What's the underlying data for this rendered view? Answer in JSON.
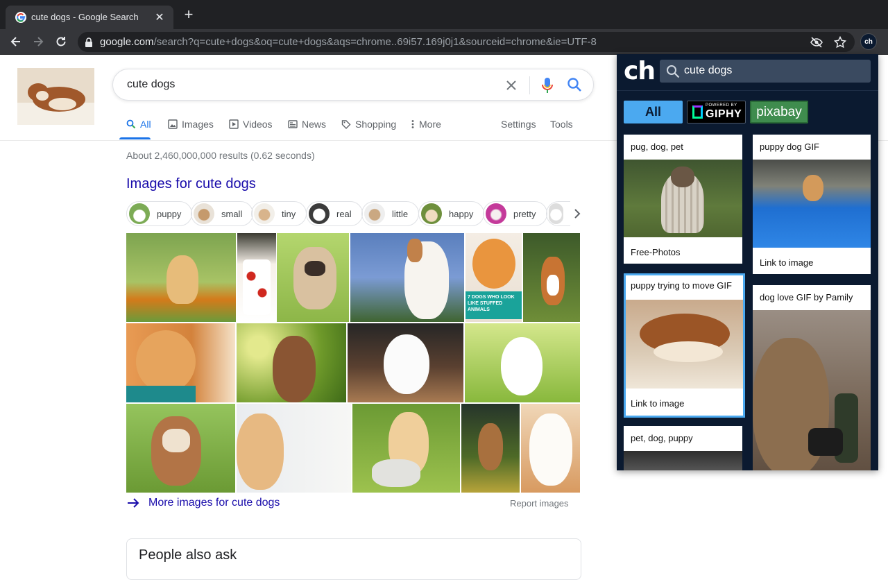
{
  "browser": {
    "tab_title": "cute dogs - Google Search",
    "tab_close": "✕",
    "new_tab": "+",
    "url_host": "google.com",
    "url_path": "/search?q=cute+dogs&oq=cute+dogs&aqs=chrome..69i57.169j0j1&sourceid=chrome&ie=UTF-8",
    "ext_button": "ch"
  },
  "google": {
    "query": "cute dogs",
    "tabs": [
      {
        "label": "All",
        "active": true
      },
      {
        "label": "Images"
      },
      {
        "label": "Videos"
      },
      {
        "label": "News"
      },
      {
        "label": "Shopping"
      },
      {
        "label": "More"
      }
    ],
    "settings": "Settings",
    "tools": "Tools",
    "results_count": "About 2,460,000,000 results (0.62 seconds)",
    "images_heading": "Images for cute dogs",
    "chips": [
      "puppy",
      "small",
      "tiny",
      "real",
      "little",
      "happy",
      "pretty"
    ],
    "overlay_text": "7 DOGS WHO LOOK LIKE STUFFED ANIMALS",
    "more_images": "More images for cute dogs",
    "report_images": "Report images",
    "people_also_ask": "People also ask"
  },
  "extension": {
    "logo": "ch",
    "search_value": "cute dogs",
    "filters": {
      "all": "All",
      "giphy_powered": "POWERED BY",
      "giphy": "GIPHY",
      "pixabay": "pixabay"
    },
    "cards_left": [
      {
        "title": "pug, dog, pet",
        "footer": "Free-Photos"
      },
      {
        "title": "puppy trying to move GIF",
        "footer": "Link to image"
      },
      {
        "title": "pet, dog, puppy",
        "footer": ""
      }
    ],
    "cards_right": [
      {
        "title": "puppy dog GIF",
        "footer": "Link to image"
      },
      {
        "title": "dog love GIF by Pamily",
        "footer": ""
      }
    ]
  }
}
